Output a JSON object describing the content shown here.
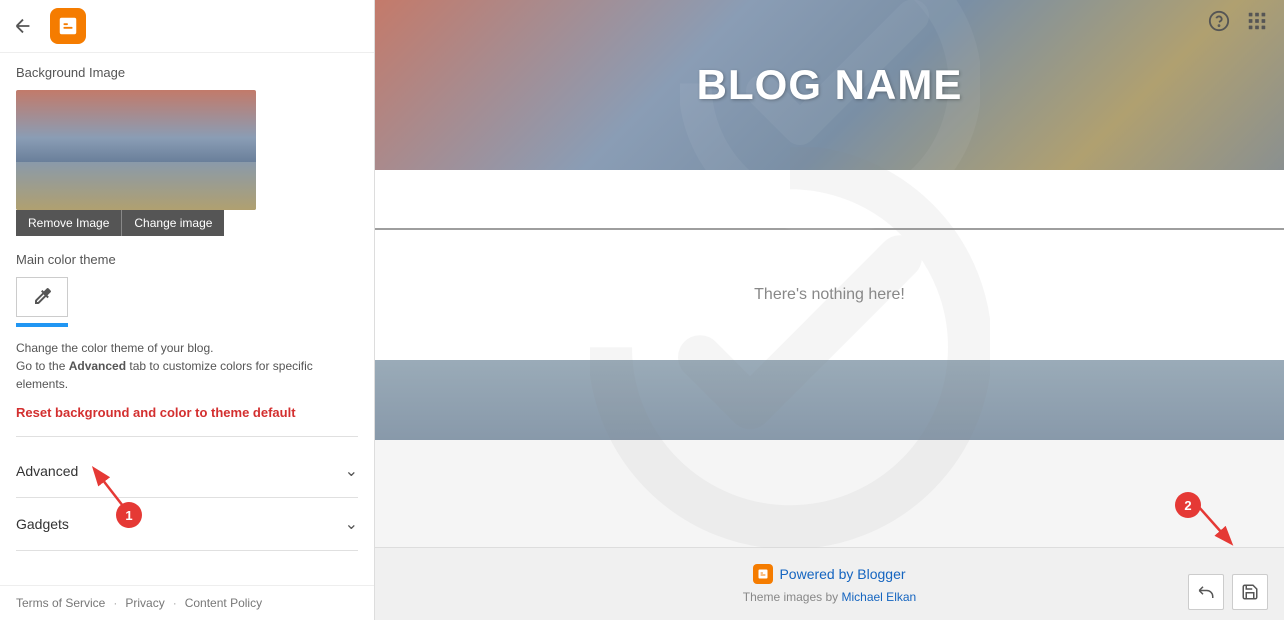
{
  "left_panel": {
    "background_image_label": "Background Image",
    "remove_image_btn": "Remove Image",
    "change_image_btn": "Change image",
    "main_color_theme_label": "Main color theme",
    "theme_description_1": "Change the color theme of your blog.",
    "theme_description_2": "Go to the ",
    "theme_description_bold": "Advanced",
    "theme_description_3": " tab to customize colors for specific elements.",
    "reset_link": "Reset background and color to theme default",
    "advanced_label": "Advanced",
    "gadgets_label": "Gadgets",
    "footer_tos": "Terms of Service",
    "footer_privacy": "Privacy",
    "footer_content_policy": "Content Policy"
  },
  "top_right": {
    "help_icon": "help-circle-icon",
    "apps_icon": "apps-grid-icon"
  },
  "blog_preview": {
    "blog_name": "BLOG NAME",
    "nothing_here": "There's nothing here!",
    "powered_by": "Powered by Blogger",
    "theme_images_text": "Theme images by",
    "theme_images_author": "Michael Elkan"
  },
  "annotations": {
    "circle1_label": "1",
    "circle2_label": "2"
  },
  "bottom_actions": {
    "undo_icon": "undo-icon",
    "save_icon": "save-icon"
  },
  "colors": {
    "accent_blue": "#2196f3",
    "reset_red": "#d32f2f",
    "blogger_orange": "#f57c00",
    "annotation_red": "#e53935",
    "powered_blue": "#1565c0"
  }
}
